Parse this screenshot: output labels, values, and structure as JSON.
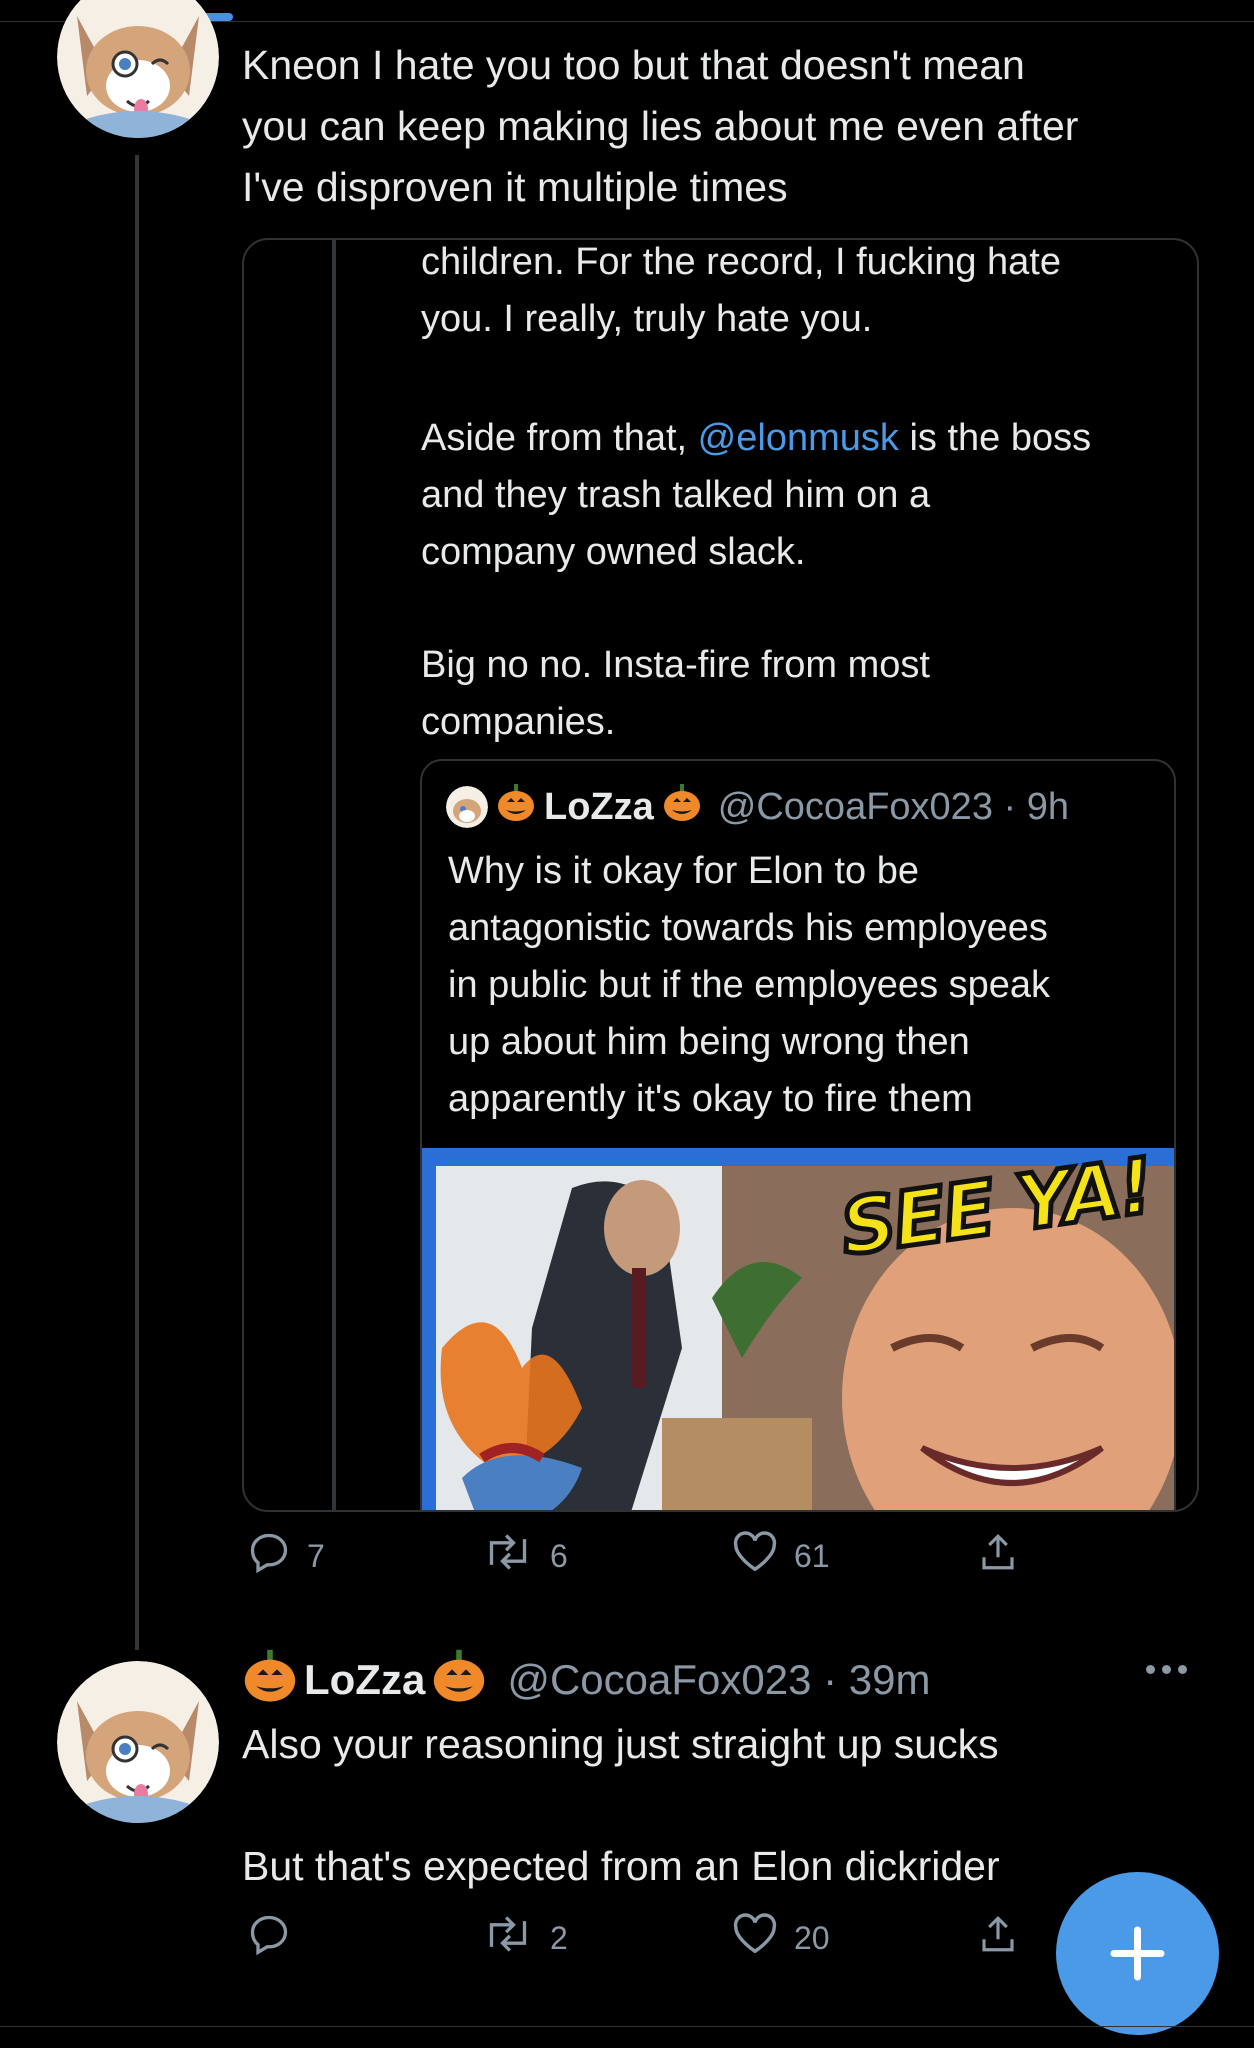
{
  "tweet1": {
    "text": "Kneon I hate you too but that doesn't mean\nyou can keep making lies about me even after\nI've disproven it multiple times"
  },
  "quote": {
    "line1": "children. For the record, I fucking hate\nyou. I really, truly hate you.",
    "para2_before": "Aside from that, ",
    "mention": "@elonmusk",
    "para2_after": " is the boss\nand they trash talked him on a\ncompany owned slack.",
    "para3": "Big no no. Insta-fire from most\ncompanies.",
    "inner": {
      "name": "LoZza",
      "handle": "@CocoaFox023 · 9h",
      "text": "Why is it okay for Elon to be\nantagonistic towards his employees\nin public but if the employees speak\nup about him being wrong then\napparently it's okay to fire them",
      "image_caption": "SEE YA!"
    }
  },
  "tweet1_actions": {
    "replies": "7",
    "retweets": "6",
    "likes": "61"
  },
  "tweet2": {
    "name": "LoZza",
    "handle": "@CocoaFox023 · 39m",
    "text": "Also your reasoning just straight up sucks\n\nBut that's expected from an Elon dickrider"
  },
  "tweet2_actions": {
    "replies": "",
    "retweets": "2",
    "likes": "20"
  },
  "colors": {
    "accent": "#4a9ae8",
    "muted": "#8b98a5",
    "border": "#2f3336"
  },
  "icons": [
    "reply-icon",
    "retweet-icon",
    "like-icon",
    "share-icon",
    "more-icon",
    "compose-icon",
    "pumpkin-icon"
  ]
}
